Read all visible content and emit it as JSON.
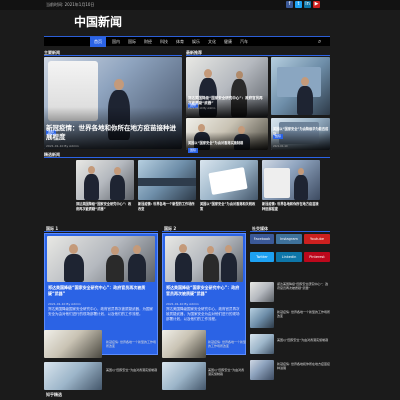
{
  "topbar": {
    "date": "当前时间: 2021年1月10日",
    "social_icons": [
      "facebook-icon",
      "twitter-icon",
      "linkedin-icon",
      "youtube-icon"
    ]
  },
  "site": {
    "logo": "中国新闻"
  },
  "nav": {
    "items": [
      "首页",
      "国内",
      "国际",
      "财经",
      "科技",
      "体育",
      "娱乐",
      "文化",
      "健康",
      "汽车"
    ],
    "search_icon": "search-icon"
  },
  "sections": {
    "main_news": "主要新闻",
    "hot": "最新推荐",
    "featured": "精选新闻",
    "col1": "国际 1",
    "col2": "国际 2",
    "social": "社交媒体",
    "bottom": "知乎精选"
  },
  "hero": {
    "tag": "国际",
    "title": "新冠疫情：世界各地和你所在地方疫苗接种进展程度",
    "meta": "2021-01-10  By Admin"
  },
  "hot_items": [
    {
      "tag": "国际",
      "title": "郑达美国降级“国家安全研究中心”：政府官员再次被质疑“武器”",
      "meta": "2021-01-10  By Admin"
    },
    {
      "tag": "国际",
      "title": "美国以“国家安全”为由降级华为能否成功",
      "meta": "2021-01-10"
    },
    {
      "tag": "国际",
      "title": "美国以“国家安全”为由对香港实施制裁",
      "meta": "2021-01-10"
    }
  ],
  "featured_items": [
    {
      "tag": "国际",
      "title": "郑达美国降级“国家安全研究中心”：政府再次被质疑“武器”",
      "meta": "2021-01-10"
    },
    {
      "tag": "国际",
      "title": "新冠疫情: 世界各地一个新型的工作场所改变",
      "meta": "2021-01-10"
    },
    {
      "tag": "国际",
      "title": "美国以“国家安全”为由对香港和关税政策",
      "meta": "2021-01-10"
    },
    {
      "tag": "国际",
      "title": "新冠疫情: 世界各地和你所在地方疫苗接种进展程度",
      "meta": "2021-01-10"
    }
  ],
  "columns": [
    {
      "main_tag": "国际",
      "main_title": "郑达美国降级“国家安全研究中心”：政府官员再次被质疑“武器”",
      "main_meta": "2021-01-10  By Admin",
      "desc": "郑达美国降级国家安全研究中心，政府官员再次被质疑武器，为国家安全为由对他们进行的现场部署计划，以及他们的工作流程。",
      "list": [
        {
          "title": "新冠疫情: 世界各地一个新型的工作场所改变",
          "meta": "2021-01-10"
        },
        {
          "title": "美国以“国家安全”为由对香港实施制裁",
          "meta": "2021-01-10"
        }
      ]
    },
    {
      "main_tag": "国际",
      "main_title": "郑达美国降级“国家安全研究中心”：政府官员再次被质疑“武器”",
      "main_meta": "2021-01-10  By Admin",
      "desc": "郑达美国降级国家安全研究中心，政府官员再次被质疑武器，为国家安全为由对他们进行的现场部署计划，以及他们的工作流程。",
      "list": [
        {
          "title": "新冠疫情: 世界各地一个新型的工作场所改变",
          "meta": "2021-01-10"
        },
        {
          "title": "美国以“国家安全”为由对香港实施制裁",
          "meta": "2021-01-10"
        }
      ]
    }
  ],
  "social_buttons": [
    {
      "label": "Facebook",
      "color": "#3b5998"
    },
    {
      "label": "Instagram",
      "color": "#3f729b"
    },
    {
      "label": "Youtube",
      "color": "#cd201f"
    },
    {
      "label": "Twitter",
      "color": "#1da1f2"
    },
    {
      "label": "Linkedin",
      "color": "#0e76a8"
    },
    {
      "label": "Pinterest",
      "color": "#bd081c"
    }
  ],
  "side_list": [
    {
      "title": "郑达美国降级“国家安全研究中心”：政府官员再次被质疑“武器”",
      "meta": "2021-01-10"
    },
    {
      "title": "新冠疫情: 世界各地一个新型的工作场所改变",
      "meta": "2021-01-10"
    },
    {
      "title": "美国以“国家安全”为由对香港实施制裁",
      "meta": "2021-01-10"
    },
    {
      "title": "新冠疫情: 世界各地和你所在地方疫苗接种进展",
      "meta": "2021-01-10"
    }
  ]
}
